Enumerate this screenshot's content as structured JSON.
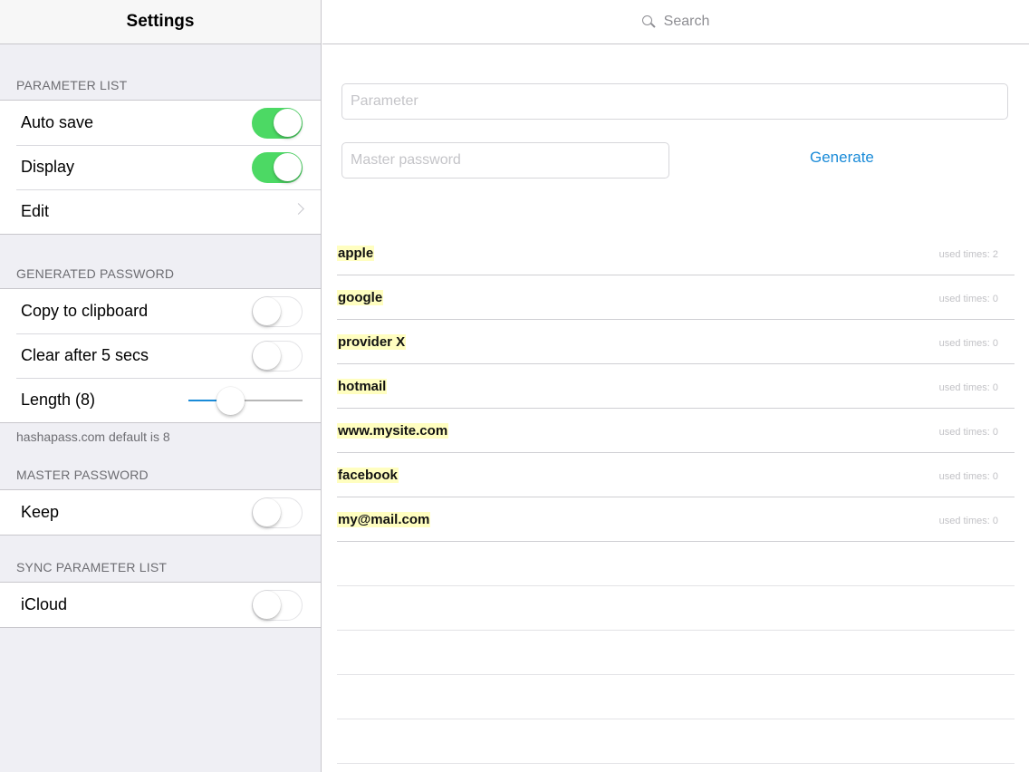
{
  "settings": {
    "title": "Settings",
    "sections": {
      "parameter_list": {
        "header": "PARAMETER LIST",
        "auto_save": {
          "label": "Auto save",
          "on": true
        },
        "display": {
          "label": "Display",
          "on": true
        },
        "edit": {
          "label": "Edit"
        }
      },
      "generated_password": {
        "header": "GENERATED PASSWORD",
        "copy": {
          "label": "Copy to clipboard",
          "on": false
        },
        "clear": {
          "label": "Clear after 5 secs",
          "on": false
        },
        "length": {
          "label": "Length (8)",
          "value": 8
        },
        "footer": "hashapass.com default is 8"
      },
      "master_password": {
        "header": "MASTER PASSWORD",
        "keep": {
          "label": "Keep",
          "on": false
        }
      },
      "sync": {
        "header": "SYNC PARAMETER LIST",
        "icloud": {
          "label": "iCloud",
          "on": false
        }
      }
    }
  },
  "main": {
    "search": {
      "placeholder": "Search"
    },
    "parameter_field": {
      "placeholder": "Parameter",
      "value": ""
    },
    "master_field": {
      "placeholder": "Master password",
      "value": ""
    },
    "generate_label": "Generate",
    "parameters": [
      {
        "name": "apple",
        "used": "used times: 2"
      },
      {
        "name": "google",
        "used": "used times: 0"
      },
      {
        "name": "provider X",
        "used": "used times: 0"
      },
      {
        "name": "hotmail",
        "used": "used times: 0"
      },
      {
        "name": "www.mysite.com",
        "used": "used times: 0"
      },
      {
        "name": "facebook",
        "used": "used times: 0"
      },
      {
        "name": "my@mail.com",
        "used": "used times: 0"
      }
    ]
  },
  "colors": {
    "accent": "#1a8bd8",
    "toggle_on": "#4cd964",
    "highlight": "#fffec0"
  }
}
